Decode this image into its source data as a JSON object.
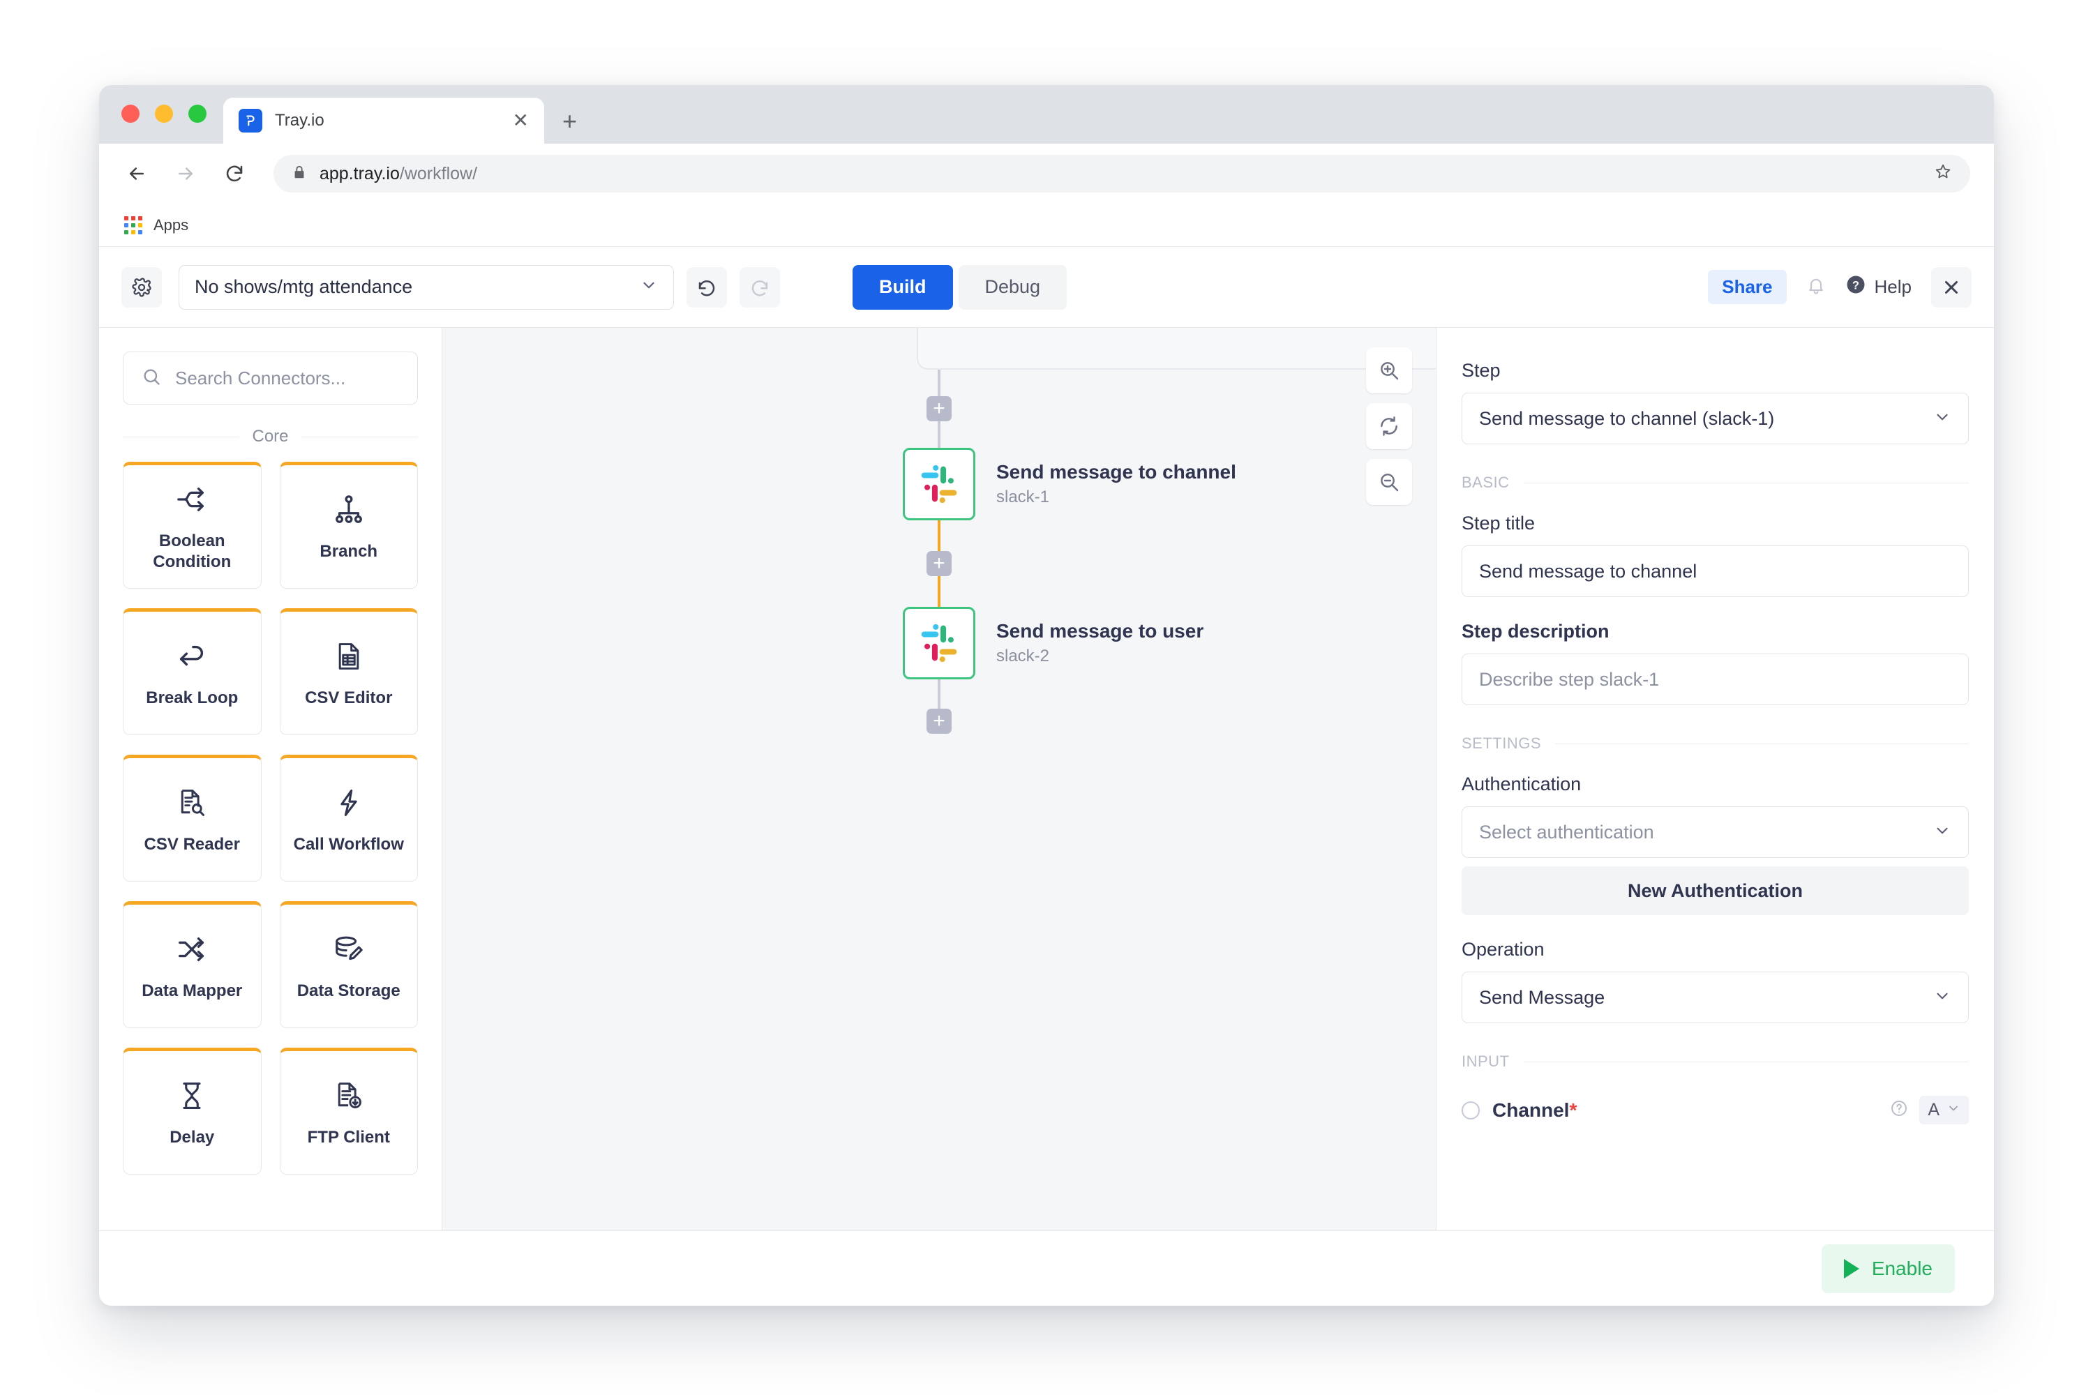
{
  "browser": {
    "tab_title": "Tray.io",
    "tab_close": "✕",
    "new_tab": "+",
    "url_host": "app.tray.io",
    "url_path": "/workflow/",
    "bookmark_label": "Apps"
  },
  "appbar": {
    "workflow_name": "No shows/mtg attendance",
    "build_label": "Build",
    "debug_label": "Debug",
    "share_label": "Share",
    "help_label": "Help"
  },
  "sidebar": {
    "search_placeholder": "Search Connectors...",
    "section_label": "Core",
    "cards": [
      {
        "label": "Boolean Condition",
        "icon": "boolean-condition-icon"
      },
      {
        "label": "Branch",
        "icon": "branch-icon"
      },
      {
        "label": "Break Loop",
        "icon": "break-loop-icon"
      },
      {
        "label": "CSV Editor",
        "icon": "csv-editor-icon"
      },
      {
        "label": "CSV Reader",
        "icon": "csv-reader-icon"
      },
      {
        "label": "Call Workflow",
        "icon": "call-workflow-icon"
      },
      {
        "label": "Data Mapper",
        "icon": "data-mapper-icon"
      },
      {
        "label": "Data Storage",
        "icon": "data-storage-icon"
      },
      {
        "label": "Delay",
        "icon": "delay-icon"
      },
      {
        "label": "FTP Client",
        "icon": "ftp-client-icon"
      }
    ]
  },
  "canvas": {
    "add_step_label": "+",
    "nodes": [
      {
        "title": "Send message to channel",
        "subtitle": "slack-1",
        "app": "slack"
      },
      {
        "title": "Send message to user",
        "subtitle": "slack-2",
        "app": "slack"
      }
    ],
    "zoom_in": "zoom-in",
    "zoom_reset": "zoom-reset",
    "zoom_out": "zoom-out"
  },
  "panel": {
    "step_label": "Step",
    "step_value": "Send message to channel (slack-1)",
    "basic_section": "BASIC",
    "step_title_label": "Step title",
    "step_title_value": "Send message to channel",
    "step_description_label": "Step description",
    "step_description_placeholder": "Describe step slack-1",
    "settings_section": "SETTINGS",
    "authentication_label": "Authentication",
    "authentication_placeholder": "Select authentication",
    "new_authentication_label": "New Authentication",
    "operation_label": "Operation",
    "operation_value": "Send Message",
    "input_section": "INPUT",
    "channel_label": "Channel",
    "channel_required": "*",
    "type_glyph": "A"
  },
  "footer": {
    "enable_label": "Enable"
  },
  "colors": {
    "brand_blue": "#1a62e8",
    "node_green": "#3fc47f",
    "connector_orange": "#f5a623",
    "enable_green": "#1fae5a",
    "required_red": "#e8463f",
    "slack_blue": "#36C5F0",
    "slack_green": "#2EB67D",
    "slack_red": "#E01E5A",
    "slack_yellow": "#ECB22E"
  }
}
